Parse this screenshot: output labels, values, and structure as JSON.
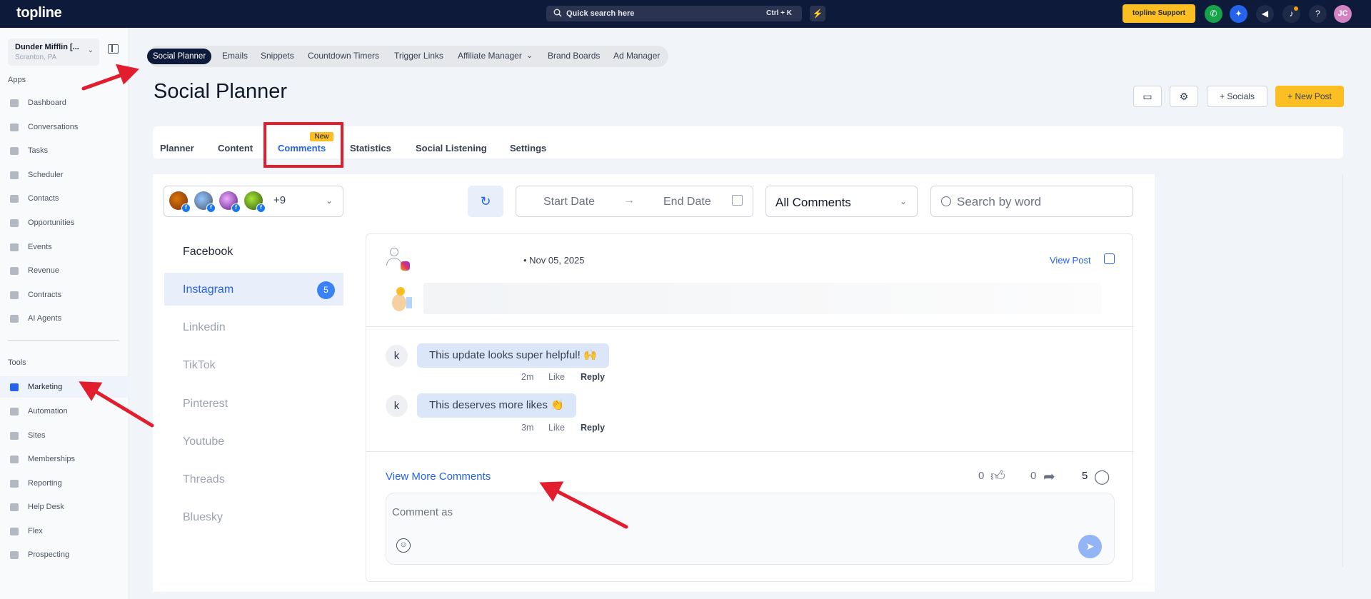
{
  "topbar": {
    "logo": "topline",
    "search_placeholder": "Quick search here",
    "search_shortcut": "Ctrl + K",
    "support_label": "topline Support",
    "avatar_initials": "JC"
  },
  "sidebar": {
    "account_name": "Dunder Mifflin [...",
    "account_location": "Scranton, PA",
    "apps_label": "Apps",
    "apps": [
      {
        "label": "Dashboard"
      },
      {
        "label": "Conversations"
      },
      {
        "label": "Tasks"
      },
      {
        "label": "Scheduler"
      },
      {
        "label": "Contacts"
      },
      {
        "label": "Opportunities"
      },
      {
        "label": "Events"
      },
      {
        "label": "Revenue"
      },
      {
        "label": "Contracts"
      },
      {
        "label": "AI Agents"
      }
    ],
    "tools_label": "Tools",
    "tools": [
      {
        "label": "Marketing"
      },
      {
        "label": "Automation"
      },
      {
        "label": "Sites"
      },
      {
        "label": "Memberships"
      },
      {
        "label": "Reporting"
      },
      {
        "label": "Help Desk"
      },
      {
        "label": "Flex"
      },
      {
        "label": "Prospecting"
      }
    ]
  },
  "subnav": {
    "items": [
      "Social Planner",
      "Emails",
      "Snippets",
      "Countdown Timers",
      "Trigger Links",
      "Affiliate Manager",
      "Brand Boards",
      "Ad Manager"
    ]
  },
  "page": {
    "title": "Social Planner",
    "socials_label": "Socials",
    "new_post_label": "New Post"
  },
  "tabs": {
    "items": [
      "Planner",
      "Content",
      "Comments",
      "Statistics",
      "Social Listening",
      "Settings"
    ],
    "new_badge": "New"
  },
  "filters": {
    "accounts_more": "+9",
    "start_date": "Start Date",
    "end_date": "End Date",
    "comment_filter": "All Comments",
    "search_placeholder": "Search by word"
  },
  "platforms": [
    {
      "label": "Facebook"
    },
    {
      "label": "Instagram",
      "count": "5"
    },
    {
      "label": "Linkedin"
    },
    {
      "label": "TikTok"
    },
    {
      "label": "Pinterest"
    },
    {
      "label": "Youtube"
    },
    {
      "label": "Threads"
    },
    {
      "label": "Bluesky"
    }
  ],
  "post": {
    "date": "Nov 05, 2025",
    "view_post": "View Post",
    "comments": [
      {
        "initial": "k",
        "text": "This update looks super helpful! 🙌",
        "time": "2m",
        "like": "Like",
        "reply": "Reply"
      },
      {
        "initial": "k",
        "text": "This deserves more likes 👏",
        "time": "3m",
        "like": "Like",
        "reply": "Reply"
      }
    ],
    "view_more": "View More Comments",
    "likes": "0",
    "shares": "0",
    "comment_count": "5",
    "comment_placeholder": "Comment as"
  },
  "colors": {
    "topbar": "#0e1a3a",
    "accent": "#2563eb",
    "cta": "#fbbf24",
    "annotation": "#e11d2e"
  }
}
